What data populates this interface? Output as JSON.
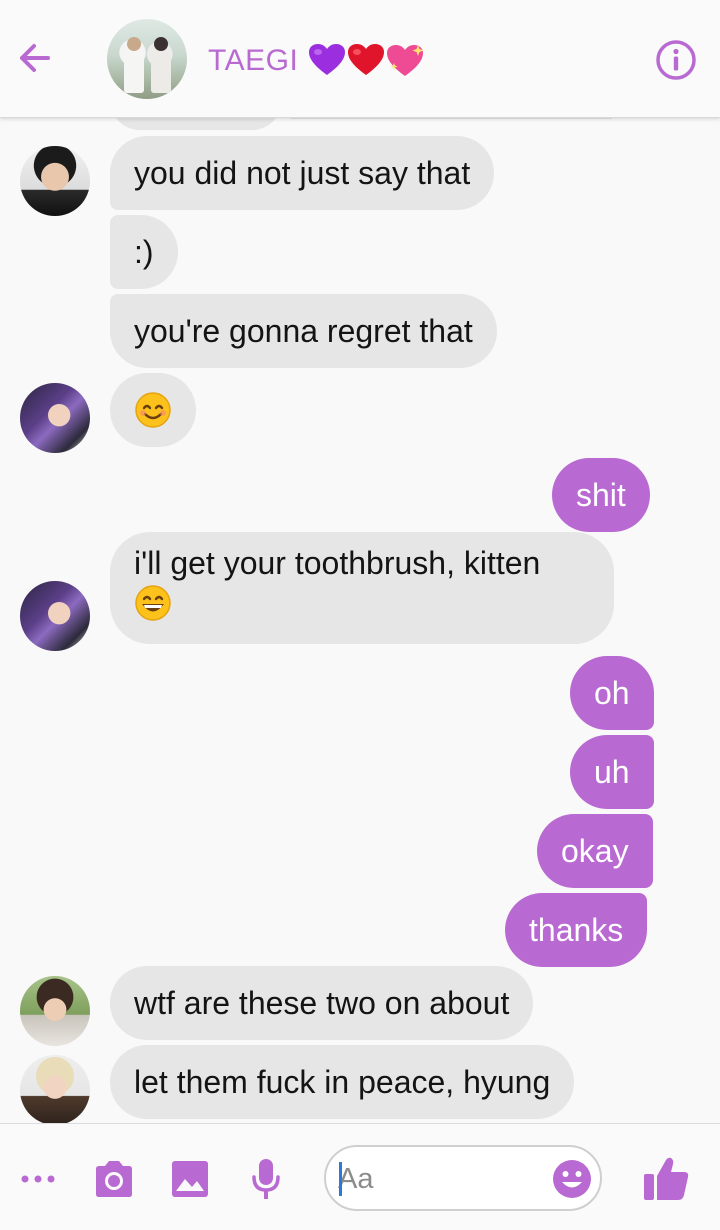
{
  "header": {
    "title": "TAEGI",
    "title_hearts": [
      "purple-heart",
      "red-heart",
      "sparkling-heart"
    ],
    "accent_color": "#b96ad2",
    "back_icon": "arrow-left-icon",
    "info_icon": "info-icon"
  },
  "messages": [
    {
      "side": "in",
      "sender_avatar": "avatar-a",
      "text": "you did not just say that"
    },
    {
      "side": "in",
      "text": ":)"
    },
    {
      "side": "in",
      "text": "you're gonna regret that"
    },
    {
      "side": "in",
      "sender_avatar": "avatar-b",
      "text": "",
      "emoji": "smiling-face-icon"
    },
    {
      "side": "out",
      "text": "shit"
    },
    {
      "side": "in",
      "sender_avatar": "avatar-b",
      "text": "i'll get your toothbrush, kitten",
      "emoji": "grinning-face-icon"
    },
    {
      "side": "out",
      "text": "oh"
    },
    {
      "side": "out",
      "text": "uh"
    },
    {
      "side": "out",
      "text": "okay"
    },
    {
      "side": "out",
      "text": "thanks"
    },
    {
      "side": "in",
      "sender_avatar": "avatar-c",
      "text": "wtf are these two on about"
    },
    {
      "side": "in",
      "sender_avatar": "avatar-d",
      "text": "let them fuck in peace, hyung"
    }
  ],
  "composer": {
    "placeholder": "Aa",
    "tools": [
      "more-icon",
      "camera-icon",
      "gallery-icon",
      "microphone-icon"
    ],
    "emoji_button": "emoji-icon",
    "send_button": "thumbs-up-icon"
  },
  "colors": {
    "incoming_bubble": "#e6e6e6",
    "outgoing_bubble": "#b96ad2",
    "background": "#f9f9f9"
  }
}
